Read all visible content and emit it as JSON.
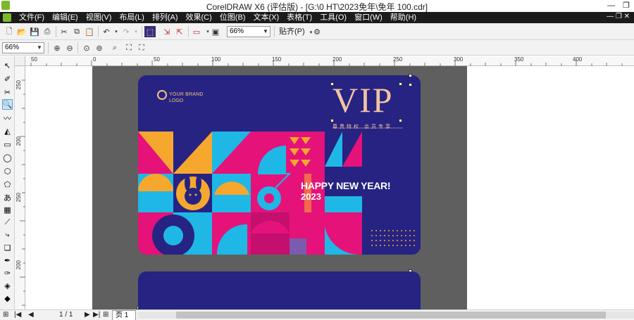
{
  "window": {
    "title": "CorelDRAW X6 (评估版) - [G:\\0 HT\\2023免年\\免年 100.cdr]",
    "minimize": "—",
    "restore": "❐"
  },
  "menu": {
    "items": [
      "文件(F)",
      "编辑(E)",
      "视图(V)",
      "布局(L)",
      "排列(A)",
      "效果(C)",
      "位图(B)",
      "文本(X)",
      "表格(T)",
      "工具(O)",
      "窗口(W)",
      "帮助(H)"
    ],
    "window_controls": "— ❐ ✕"
  },
  "toolbar": {
    "zoom_value": "66%",
    "snap_label": "贴齐(P)"
  },
  "property_bar": {
    "zoom_value": "66%"
  },
  "ruler": {
    "h_labels": [
      "50",
      "0",
      "50",
      "100",
      "150",
      "200",
      "250",
      "300",
      "350",
      "400"
    ],
    "v_labels": [
      "250",
      "200",
      "250",
      "200"
    ]
  },
  "design": {
    "logo_text": "YOUR BRAND",
    "logo_sub": "LOGO",
    "vip": "VIP",
    "vip_sub": "尊贵特权 会员专享",
    "greeting": "HAPPY NEW YEAR!",
    "year": "2023"
  },
  "status": {
    "page_count": "1 / 1",
    "page_tab": "页 1"
  },
  "colors": {
    "navy": "#262383",
    "magenta": "#e5127a",
    "cyan": "#1fb7e6",
    "orange": "#f6a72e",
    "gold": "#f2c3a0"
  }
}
